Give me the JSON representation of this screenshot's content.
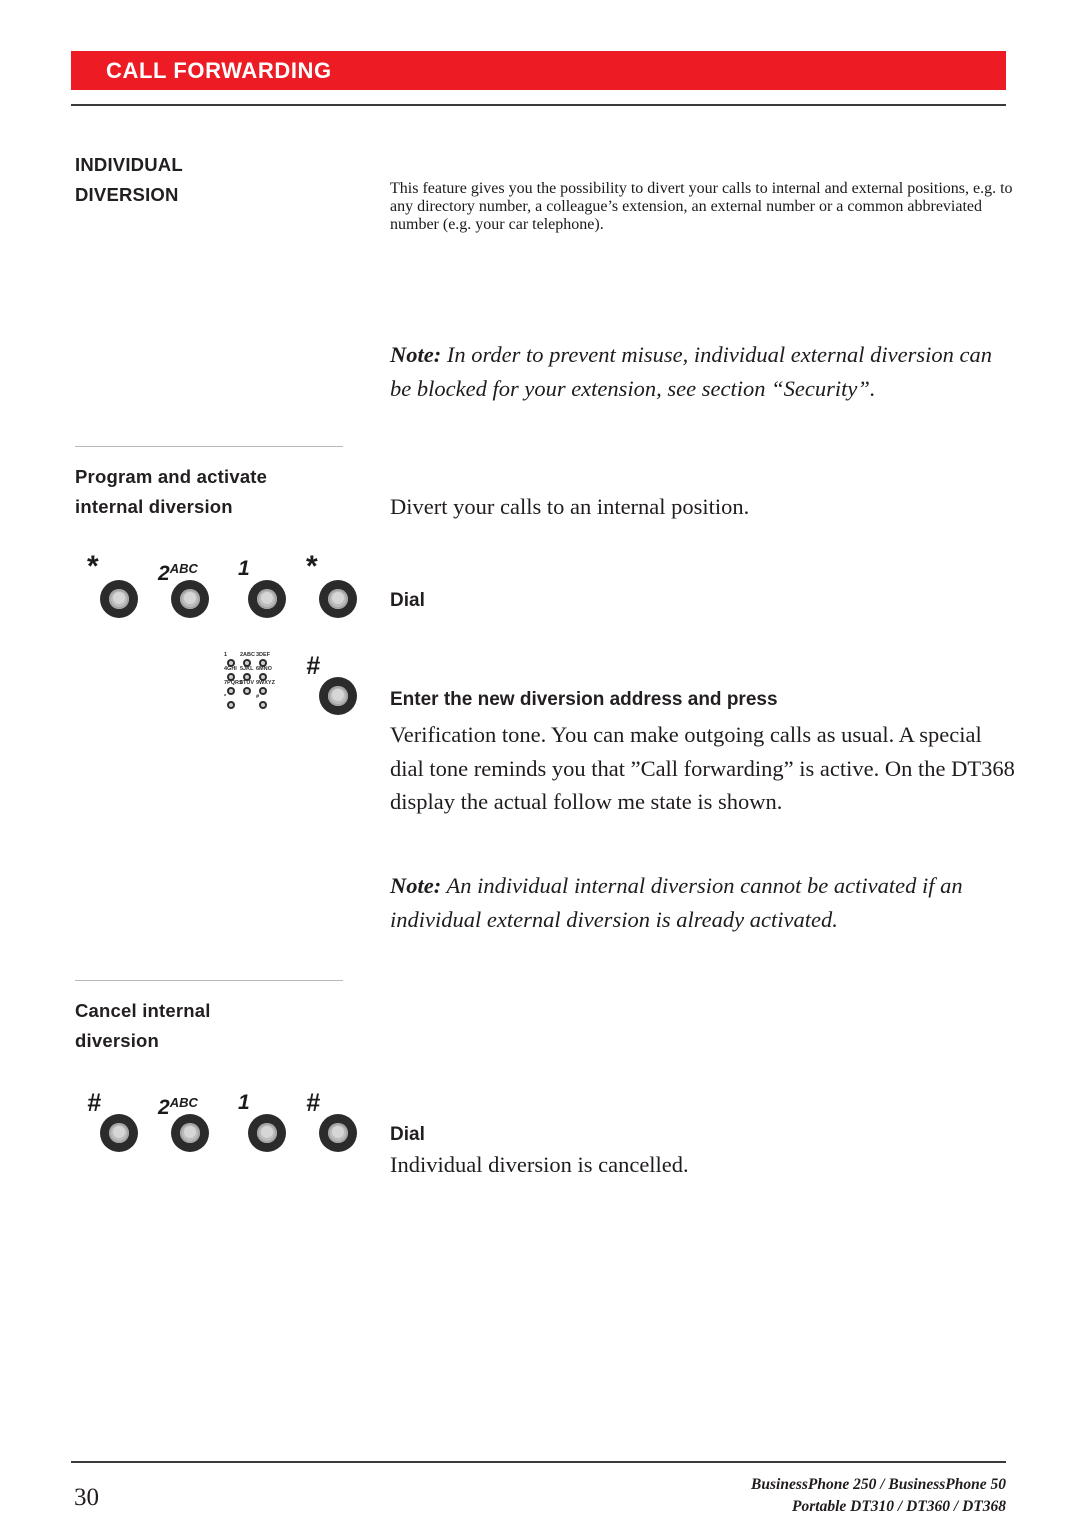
{
  "header": {
    "title": "CALL FORWARDING"
  },
  "accent_color": "#ed1c24",
  "sections": {
    "individual_diversion": {
      "heading_line1": "INDIVIDUAL",
      "heading_line2": "DIVERSION",
      "paragraph": "This feature gives you the possibility to divert your calls to internal and external positions, e.g. to any directory number, a colleague’s extension, an external number or a common abbreviated number (e.g. your car telephone).",
      "note_label": "Note:",
      "note_body": " In order to prevent misuse, individual external diversion can be blocked for your extension, see section “Security”."
    },
    "program_activate": {
      "heading_line1": "Program and activate",
      "heading_line2": "internal diversion",
      "intro": "Divert your calls to an internal position.",
      "step1": {
        "keys": [
          {
            "label": "*",
            "kind": "star"
          },
          {
            "label": "2",
            "sup": "ABC",
            "kind": "digit"
          },
          {
            "label": "1",
            "kind": "digit"
          },
          {
            "label": "*",
            "kind": "star"
          }
        ],
        "action": "Dial"
      },
      "step2": {
        "keypad_icon": "dialpad-icon",
        "keys": [
          {
            "label": "#",
            "kind": "hash"
          }
        ],
        "action": "Enter the new diversion address and press",
        "paragraph": "Verification tone. You can make outgoing calls as usual. A special dial tone reminds you that ”Call forwarding” is active. On the DT368 display the actual follow me state is shown."
      },
      "note_label": "Note:",
      "note_body": " An individual internal diversion cannot be activated if an individual external diversion is already activated."
    },
    "cancel_internal": {
      "heading_line1": "Cancel internal",
      "heading_line2": "diversion",
      "step1": {
        "keys": [
          {
            "label": "#",
            "kind": "hash"
          },
          {
            "label": "2",
            "sup": "ABC",
            "kind": "digit"
          },
          {
            "label": "1",
            "kind": "digit"
          },
          {
            "label": "#",
            "kind": "hash"
          }
        ],
        "action": "Dial",
        "result": "Individual diversion is cancelled."
      }
    }
  },
  "keypad_icon_labels": [
    [
      "1",
      "2ABC",
      "3DEF"
    ],
    [
      "4GHI",
      "5JKL",
      "6MNO"
    ],
    [
      "7PQRS",
      "8TUV",
      "9WXYZ"
    ],
    [
      "*",
      "0",
      "#"
    ]
  ],
  "footer": {
    "page_number": "30",
    "product_line1": "BusinessPhone 250 / BusinessPhone 50",
    "product_line2": "Portable DT310 / DT360 / DT368"
  }
}
